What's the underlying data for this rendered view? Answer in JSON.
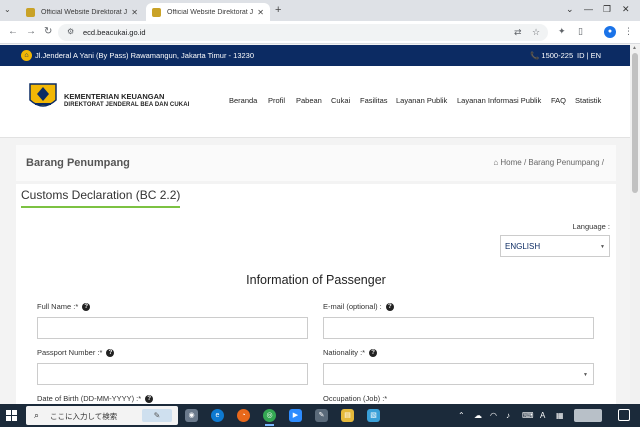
{
  "browser": {
    "tabs": [
      {
        "title": "Official Website Direktorat Jenderal Bea dan Cukai",
        "close": "✕"
      },
      {
        "title": "Official Website Direktorat Jenderal Bea dan Cukai",
        "close": "✕"
      }
    ],
    "new_tab": "+",
    "url": "ecd.beacukai.go.id",
    "window_controls": [
      "⌄",
      "—",
      "❐",
      "✕"
    ]
  },
  "topbar": {
    "address": "Jl.Jenderal A Yani (By Pass) Rawamangun, Jakarta Timur - 13230",
    "phone": "📞 1500-225",
    "lang_switch": "ID | EN"
  },
  "header": {
    "brand_line1": "KEMENTERIAN KEUANGAN",
    "brand_line2": "DIREKTORAT JENDERAL BEA DAN CUKAI",
    "menu": [
      "Beranda",
      "Profil",
      "Pabean",
      "Cukai",
      "Fasilitas",
      "Layanan Publik",
      "Layanan Informasi Publik",
      "FAQ",
      "Statistik"
    ]
  },
  "breadcrumb": {
    "page_title": "Barang Penumpang",
    "trail": "⌂ Home  /  Barang Penumpang  /"
  },
  "form": {
    "declaration_title": "Customs Declaration (BC 2.2)",
    "language_label": "Language :",
    "language_value": "ENGLISH",
    "section_title": "Information of Passenger",
    "fields": {
      "full_name": "Full Name :*",
      "email": "E-mail (optional) :",
      "passport": "Passport Number :*",
      "nationality": "Nationality :*",
      "dob": "Date of Birth (DD-MM-YYYY) :*",
      "occupation": "Occupation (Job) :*"
    },
    "help_glyph": "?"
  },
  "taskbar": {
    "search_placeholder": "ここに入力して検索",
    "apps": [
      "camera-app",
      "edge-browser",
      "firefox-browser",
      "chrome-browser",
      "zoom-app",
      "pen-app",
      "file-explorer",
      "notes-app"
    ]
  },
  "colors": {
    "navy": "#0c2b63",
    "accent_green": "#7cc242",
    "gold": "#f2b705"
  }
}
